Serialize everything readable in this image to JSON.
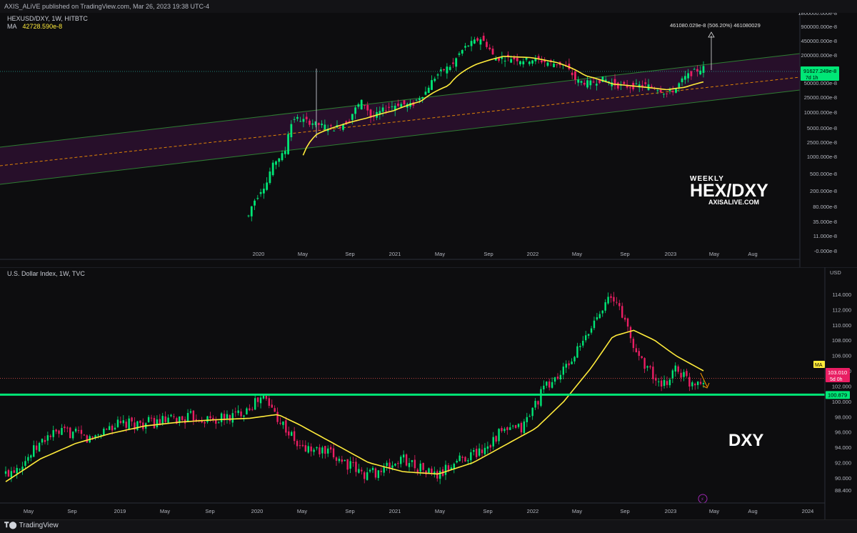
{
  "header": {
    "publish_line": "AXIS_ALiVE published on TradingView.com, Mar 26, 2023 19:38 UTC-4"
  },
  "footer": {
    "brand": "TradingView",
    "brand_icon": "tradingview-logo-icon"
  },
  "colors": {
    "up": "#26a69a",
    "up_bright": "#00e676",
    "down": "#ef5350",
    "down_pink": "#e91e63",
    "ma": "#ffeb3b",
    "channel": "#2e7d32",
    "channel_fill": "#2a0f2e",
    "hline": "#00e676",
    "dashed": "#ff9800"
  },
  "chart_data": [
    {
      "type": "candlestick",
      "panel": "top",
      "symbol_line": "HEXUSD/DXY, 1W, HITBTC",
      "ma_label": "MA",
      "ma_value": "42728.590e-8",
      "scale": "log",
      "y_ticks": [
        "1800000.000e-8",
        "900000.000e-8",
        "450000.000e-8",
        "200000.000e-8",
        "100000.000e-8",
        "50000.000e-8",
        "25000.000e-8",
        "10000.000e-8",
        "5000.000e-8",
        "2500.000e-8",
        "1000.000e-8",
        "500.000e-8",
        "200.000e-8",
        "80.000e-8",
        "35.000e-8",
        "11.000e-8",
        "-0.000e-8"
      ],
      "x_ticks": [
        "2020",
        "May",
        "Sep",
        "2021",
        "May",
        "Sep",
        "2022",
        "May",
        "Sep",
        "2023",
        "May",
        "Aug"
      ],
      "last_price_label": "91627.249e-8",
      "last_price_time": "7d 1h",
      "target_annotation": "461080.029e-8 (506.20%) 461080029",
      "close_path": [
        [
          0.0,
          30
        ],
        [
          0.02,
          90
        ],
        [
          0.04,
          180
        ],
        [
          0.06,
          600
        ],
        [
          0.08,
          900
        ],
        [
          0.1,
          6000
        ],
        [
          0.13,
          5000
        ],
        [
          0.16,
          4000
        ],
        [
          0.19,
          3500
        ],
        [
          0.22,
          5000
        ],
        [
          0.25,
          15000
        ],
        [
          0.27,
          5500
        ],
        [
          0.3,
          10000
        ],
        [
          0.33,
          13000
        ],
        [
          0.36,
          12000
        ],
        [
          0.39,
          25000
        ],
        [
          0.42,
          70000
        ],
        [
          0.45,
          110000
        ],
        [
          0.48,
          300000
        ],
        [
          0.51,
          450000
        ],
        [
          0.54,
          150000
        ],
        [
          0.57,
          160000
        ],
        [
          0.6,
          140000
        ],
        [
          0.63,
          145000
        ],
        [
          0.66,
          120000
        ],
        [
          0.69,
          110000
        ],
        [
          0.72,
          45000
        ],
        [
          0.75,
          40000
        ],
        [
          0.78,
          50000
        ],
        [
          0.81,
          35000
        ],
        [
          0.84,
          33000
        ],
        [
          0.87,
          36000
        ],
        [
          0.9,
          30000
        ],
        [
          0.92,
          22000
        ],
        [
          0.94,
          30000
        ],
        [
          0.96,
          55000
        ],
        [
          0.98,
          75000
        ],
        [
          1.0,
          91627
        ]
      ],
      "ma_path": [
        [
          0.12,
          800
        ],
        [
          0.15,
          2500
        ],
        [
          0.2,
          4000
        ],
        [
          0.26,
          6000
        ],
        [
          0.32,
          9000
        ],
        [
          0.38,
          15000
        ],
        [
          0.44,
          35000
        ],
        [
          0.5,
          110000
        ],
        [
          0.56,
          170000
        ],
        [
          0.62,
          160000
        ],
        [
          0.68,
          120000
        ],
        [
          0.74,
          60000
        ],
        [
          0.8,
          38000
        ],
        [
          0.86,
          33000
        ],
        [
          0.92,
          28000
        ],
        [
          0.96,
          32000
        ],
        [
          1.0,
          42728
        ]
      ]
    },
    {
      "type": "candlestick",
      "panel": "bottom",
      "symbol_line": "U.S. Dollar Index, 1W, TVC",
      "currency": "USD",
      "y_ticks": [
        "114.000",
        "112.000",
        "110.000",
        "108.000",
        "106.000",
        "104.000",
        "102.000",
        "100.000",
        "98.000",
        "96.000",
        "94.000",
        "92.000",
        "90.000",
        "88.400"
      ],
      "x_ticks": [
        "May",
        "Sep",
        "2019",
        "May",
        "Sep",
        "2020",
        "May",
        "Sep",
        "2021",
        "May",
        "Sep",
        "2022",
        "May",
        "Sep",
        "2023",
        "May",
        "Aug",
        "2024"
      ],
      "ma_badge": "MA",
      "last_price_label": "103.010",
      "last_price_time": "5d 0h",
      "hline_label": "100.879",
      "hline_value": 100.879,
      "last_close": 103.01,
      "close_path": [
        [
          0.0,
          90.5
        ],
        [
          0.03,
          92.5
        ],
        [
          0.06,
          95.5
        ],
        [
          0.09,
          96.0
        ],
        [
          0.12,
          95.0
        ],
        [
          0.15,
          96.8
        ],
        [
          0.18,
          97.0
        ],
        [
          0.21,
          97.2
        ],
        [
          0.24,
          97.5
        ],
        [
          0.27,
          98.0
        ],
        [
          0.3,
          97.5
        ],
        [
          0.33,
          98.2
        ],
        [
          0.35,
          99.5
        ],
        [
          0.37,
          100.5
        ],
        [
          0.39,
          98.0
        ],
        [
          0.42,
          94.0
        ],
        [
          0.45,
          93.5
        ],
        [
          0.48,
          92.5
        ],
        [
          0.51,
          90.5
        ],
        [
          0.54,
          91.0
        ],
        [
          0.57,
          92.5
        ],
        [
          0.6,
          91.0
        ],
        [
          0.62,
          90.2
        ],
        [
          0.65,
          92.5
        ],
        [
          0.68,
          93.5
        ],
        [
          0.71,
          96.0
        ],
        [
          0.74,
          96.5
        ],
        [
          0.77,
          101.5
        ],
        [
          0.8,
          104.0
        ],
        [
          0.83,
          108.0
        ],
        [
          0.86,
          113.5
        ],
        [
          0.88,
          112.5
        ],
        [
          0.9,
          107.0
        ],
        [
          0.92,
          104.5
        ],
        [
          0.94,
          101.5
        ],
        [
          0.96,
          104.5
        ],
        [
          0.98,
          102.5
        ],
        [
          1.0,
          103.01
        ]
      ],
      "ma_path": [
        [
          0.0,
          89.5
        ],
        [
          0.05,
          92.5
        ],
        [
          0.1,
          94.5
        ],
        [
          0.15,
          95.8
        ],
        [
          0.2,
          96.8
        ],
        [
          0.25,
          97.3
        ],
        [
          0.3,
          97.6
        ],
        [
          0.35,
          97.8
        ],
        [
          0.39,
          98.3
        ],
        [
          0.42,
          97.0
        ],
        [
          0.47,
          94.5
        ],
        [
          0.52,
          92.0
        ],
        [
          0.57,
          90.8
        ],
        [
          0.62,
          90.5
        ],
        [
          0.67,
          92.0
        ],
        [
          0.72,
          94.5
        ],
        [
          0.76,
          96.5
        ],
        [
          0.8,
          100.0
        ],
        [
          0.84,
          104.5
        ],
        [
          0.87,
          108.5
        ],
        [
          0.9,
          109.3
        ],
        [
          0.93,
          108.0
        ],
        [
          0.96,
          106.0
        ],
        [
          1.0,
          104.0
        ]
      ]
    }
  ],
  "watermarks": {
    "top_small": "WEEKLY",
    "top_big": "HEX/DXY",
    "top_site": "AXISALIVE.COM",
    "bottom": "DXY"
  }
}
